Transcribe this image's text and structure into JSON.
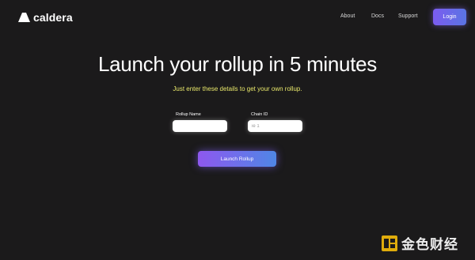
{
  "brand": {
    "name": "caldera",
    "logo_icon": "caldera-mountain-icon"
  },
  "nav": {
    "items": [
      {
        "label": "About"
      },
      {
        "label": "Docs"
      },
      {
        "label": "Support"
      }
    ],
    "login_label": "Login"
  },
  "hero": {
    "title": "Launch your rollup in 5 minutes",
    "subtitle": "Just enter these details to get your own rollup."
  },
  "form": {
    "rollup_name": {
      "label": "Rollup Name",
      "value": "",
      "placeholder": ""
    },
    "chain_id": {
      "label": "Chain ID",
      "value": "",
      "placeholder": "ie 1"
    },
    "submit_label": "Launch Rollup"
  },
  "watermark": {
    "text": "金色财经",
    "icon": "jinse-logo-icon"
  },
  "colors": {
    "background": "#1b1a1b",
    "subtitle": "#e9e86b",
    "accent_start": "#8e58ef",
    "accent_end": "#4f86e6",
    "watermark_gold": "#f0b90b"
  }
}
